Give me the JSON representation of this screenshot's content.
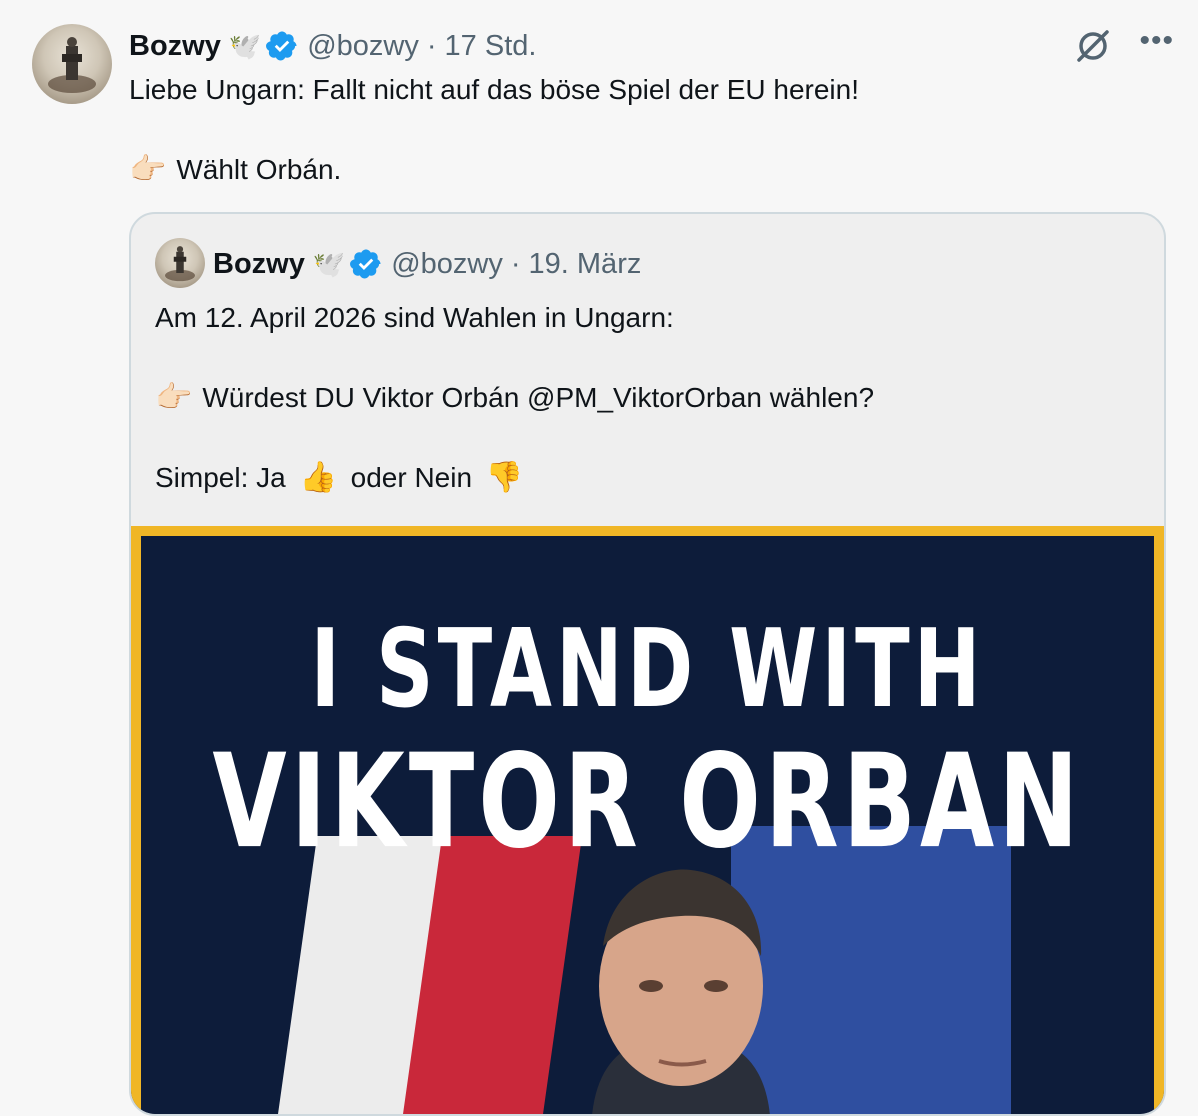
{
  "tweet": {
    "author_name": "Bozwy",
    "author_emoji": "🕊️",
    "handle": "@bozwy",
    "separator": "·",
    "time": "17 Std.",
    "lines": [
      "Liebe Ungarn: Fallt nicht auf das böse Spiel der EU herein!",
      "Wählt Orbán."
    ],
    "pointer_emoji": "👉🏻",
    "icons": {
      "avatar": "avatar",
      "verified": "verified-badge-icon",
      "nosign": "no-sign-icon",
      "more": "more-icon"
    }
  },
  "quote": {
    "author_name": "Bozwy",
    "author_emoji": "🕊️",
    "handle": "@bozwy",
    "separator": "·",
    "date": "19. März",
    "line1": "Am 12. April 2026 sind Wahlen in Ungarn:",
    "pointer_emoji": "👉🏻",
    "line2": "Würdest DU Viktor Orbán @PM_ViktorOrban wählen?",
    "line3_prefix": "Simpel: Ja",
    "thumbs_up": "👍",
    "line3_mid": "oder Nein",
    "thumbs_down": "👎",
    "image_text": [
      "I STAND WITH",
      "VIKTOR ORBAN"
    ]
  },
  "colors": {
    "verified": "#1d9bf0",
    "poster_bg": "#0d1c3a",
    "poster_border": "#f0b626",
    "muted": "#536471"
  }
}
